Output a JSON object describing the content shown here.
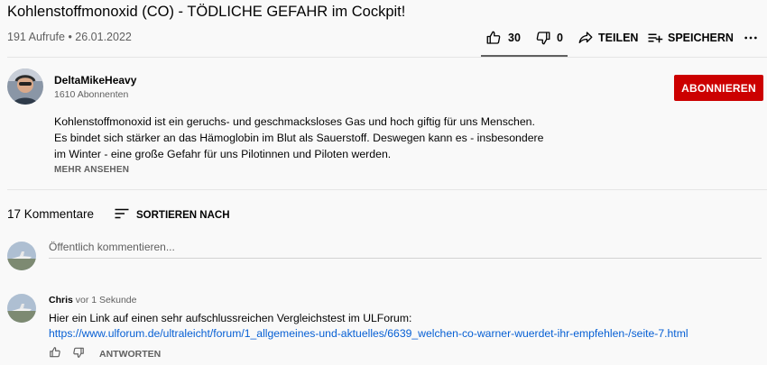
{
  "video": {
    "title": "Kohlenstoffmonoxid (CO) - TÖDLICHE GEFAHR im Cockpit!",
    "views": "191 Aufrufe",
    "date": "26.01.2022",
    "likes": "30",
    "dislikes": "0",
    "share_label": "TEILEN",
    "save_label": "SPEICHERN"
  },
  "channel": {
    "name": "DeltaMikeHeavy",
    "subscribers": "1610 Abonnenten",
    "subscribe_label": "ABONNIEREN"
  },
  "description": {
    "lines": [
      "Kohlenstoffmonoxid ist ein geruchs- und geschmacksloses Gas und hoch giftig für uns Menschen.",
      "Es bindet sich stärker an das Hämoglobin im Blut als Sauerstoff. Deswegen kann es - insbesondere",
      "im Winter - eine große Gefahr für uns Pilotinnen und Piloten werden."
    ],
    "more_label": "MEHR ANSEHEN"
  },
  "comments": {
    "count_label": "17 Kommentare",
    "sort_label": "SORTIEREN NACH",
    "input_placeholder": "Öffentlich kommentieren...",
    "items": [
      {
        "author": "Chris",
        "time": "vor 1 Sekunde",
        "text": "Hier ein Link auf einen sehr aufschlussreichen Vergleichstest im ULForum:",
        "link": "https://www.ulforum.de/ultraleicht/forum/1_allgemeines-und-aktuelles/6639_welchen-co-warner-wuerdet-ihr-empfehlen-/seite-7.html",
        "reply_label": "ANTWORTEN"
      }
    ]
  },
  "icons": {
    "like": "thumbs-up-icon",
    "dislike": "thumbs-down-icon",
    "share": "share-arrow-icon",
    "save": "playlist-add-icon",
    "more": "more-horizontal-icon",
    "sort": "sort-lines-icon"
  },
  "colors": {
    "subscribe": "#cc0000",
    "link": "#065fd4",
    "secondary_text": "#606060",
    "background": "#f9f9f9"
  }
}
